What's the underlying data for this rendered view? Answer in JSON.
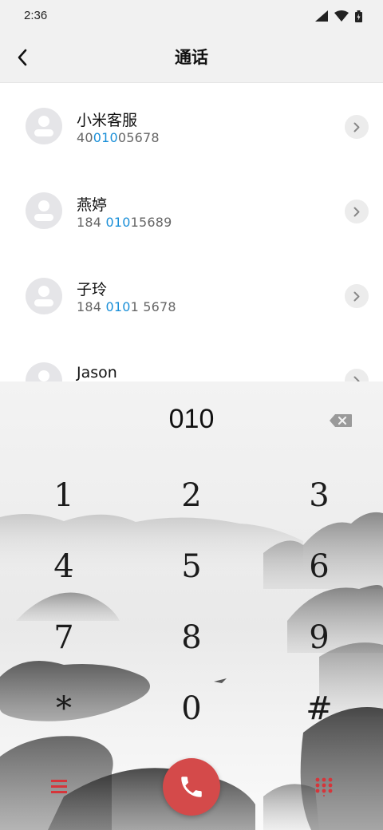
{
  "status_bar": {
    "time": "2:36"
  },
  "header": {
    "title": "通话"
  },
  "contacts": [
    {
      "name": "小米客服",
      "number_parts": [
        "40",
        "010",
        "05678"
      ]
    },
    {
      "name": "燕婷",
      "number_parts": [
        "184 ",
        "010",
        "15689"
      ]
    },
    {
      "name": "子玲",
      "number_parts": [
        "184 ",
        "010",
        "1 5678"
      ]
    },
    {
      "name": "Jason",
      "number_parts": [
        "",
        "",
        ""
      ]
    }
  ],
  "dialer": {
    "input": "010",
    "keys": [
      "1",
      "2",
      "3",
      "4",
      "5",
      "6",
      "7",
      "8",
      "9",
      "*",
      "0",
      "#"
    ]
  },
  "colors": {
    "highlight": "#1a8fd8",
    "call_button": "#d44a4a",
    "accent_red": "#d6353a"
  },
  "icons": {
    "back": "chevron-left-icon",
    "row_action": "chevron-right-icon",
    "backspace": "backspace-icon",
    "menu": "menu-icon",
    "call": "phone-icon",
    "dialpad": "dialpad-icon"
  }
}
